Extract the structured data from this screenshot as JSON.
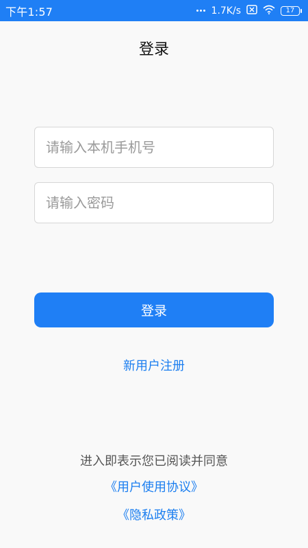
{
  "status_bar": {
    "time": "下午1:57",
    "network_speed": "1.7K/s",
    "battery_level": "17",
    "icons": [
      "signal-dots-icon",
      "sim-off-icon",
      "wifi-icon",
      "battery-icon"
    ]
  },
  "header": {
    "title": "登录"
  },
  "form": {
    "phone_placeholder": "请输入本机手机号",
    "password_placeholder": "请输入密码",
    "login_label": "登录"
  },
  "links": {
    "register": "新用户注册",
    "agree_text": "进入即表示您已阅读并同意",
    "user_agreement": "《用户使用协议》",
    "privacy_policy": "《隐私政策》"
  },
  "colors": {
    "accent": "#1f7ff5",
    "link": "#1b7ef0",
    "background": "#f9f9f9"
  }
}
